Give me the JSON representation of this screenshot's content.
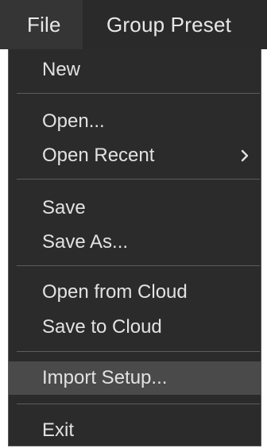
{
  "menubar": {
    "items": [
      {
        "label": "File"
      },
      {
        "label": "Group Preset"
      }
    ]
  },
  "file_menu": {
    "items": [
      {
        "label": "New"
      },
      {
        "label": "Open..."
      },
      {
        "label": "Open Recent",
        "has_submenu": true,
        "submenu_icon": "chevron-right-icon"
      },
      {
        "label": "Save"
      },
      {
        "label": "Save As..."
      },
      {
        "label": "Open from Cloud"
      },
      {
        "label": "Save to Cloud"
      },
      {
        "label": "Import Setup...",
        "highlighted": true
      },
      {
        "label": "Exit"
      }
    ]
  },
  "colors": {
    "menu_background": "#2b2b2b",
    "menubar_background": "#2a2a2a",
    "active_menubar_item": "#353535",
    "highlight": "#4a4a4a",
    "text": "#e2e2e2",
    "separator": "#5d5d5d"
  }
}
